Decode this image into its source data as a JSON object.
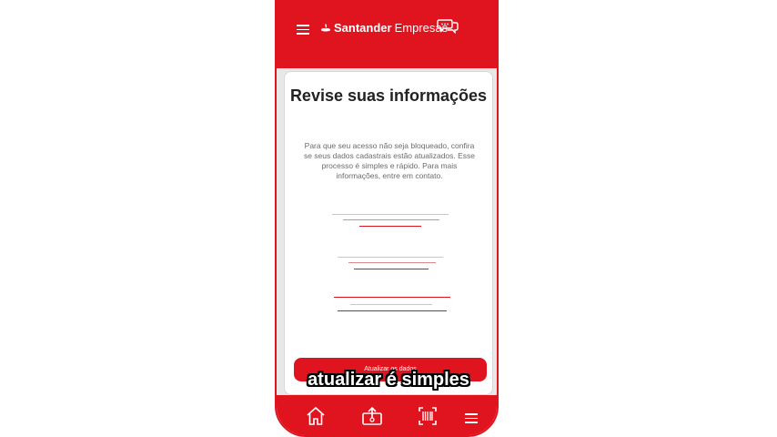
{
  "header": {
    "brand_name": "Santander",
    "brand_suffix": "Empresas"
  },
  "card": {
    "title": "Revise suas informações",
    "description": "Para que seu acesso não seja bloqueado, confira se seus dados cadastrais estão atualizados. Esse processo é simples e rápido. Para mais informações, entre em contato.",
    "button_label": "Atualizar os dados"
  },
  "bottom_nav": {
    "icons": [
      "home-icon",
      "transfer-icon",
      "barcode-icon",
      "menu-icon"
    ]
  },
  "caption": {
    "text": "atualizar é simples"
  },
  "colors": {
    "brand_red": "#e0141e",
    "text_dark": "#222222",
    "text_muted": "#6b6b6b"
  }
}
